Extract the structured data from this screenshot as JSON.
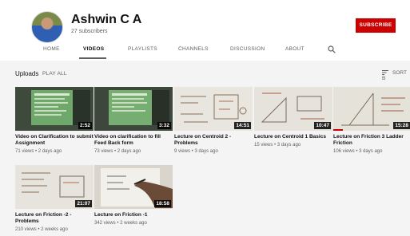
{
  "channel": {
    "name": "Ashwin C A",
    "subscribers": "27 subscribers",
    "subscribe_label": "SUBSCRIBE"
  },
  "tabs": [
    "HOME",
    "VIDEOS",
    "PLAYLISTS",
    "CHANNELS",
    "DISCUSSION",
    "ABOUT"
  ],
  "active_tab": "VIDEOS",
  "section": {
    "title": "Uploads",
    "play_all": "PLAY ALL",
    "sort_label": "SORT B"
  },
  "videos": [
    {
      "title": "Video on Clarification to submit Assignment",
      "meta": "71 views • 2 days ago",
      "duration": "2:52",
      "thumb": "green-screen"
    },
    {
      "title": "Video on clarification to fill Feed Back form",
      "meta": "73 views • 2 days ago",
      "duration": "3:32",
      "thumb": "green-screen"
    },
    {
      "title": "Lecture on Centroid 2 - Problems",
      "meta": "9 views • 3 days ago",
      "duration": "14:51",
      "thumb": "whiteboard"
    },
    {
      "title": "Lecture on Centroid 1 Basics",
      "meta": "15 views • 3 days ago",
      "duration": "10:47",
      "thumb": "whiteboard"
    },
    {
      "title": "Lecture on Friction 3 Ladder Friction",
      "meta": "106 views • 3 days ago",
      "duration": "15:28",
      "thumb": "whiteboard"
    },
    {
      "title": "Lecture on Friction -2 - Problems",
      "meta": "210 views • 2 weeks ago",
      "duration": "21:07",
      "thumb": "whiteboard"
    },
    {
      "title": "Lecture on Friction -1",
      "meta": "342 views • 2 weeks ago",
      "duration": "18:58",
      "thumb": "paper-hand"
    }
  ],
  "watched_progress": 0.12
}
